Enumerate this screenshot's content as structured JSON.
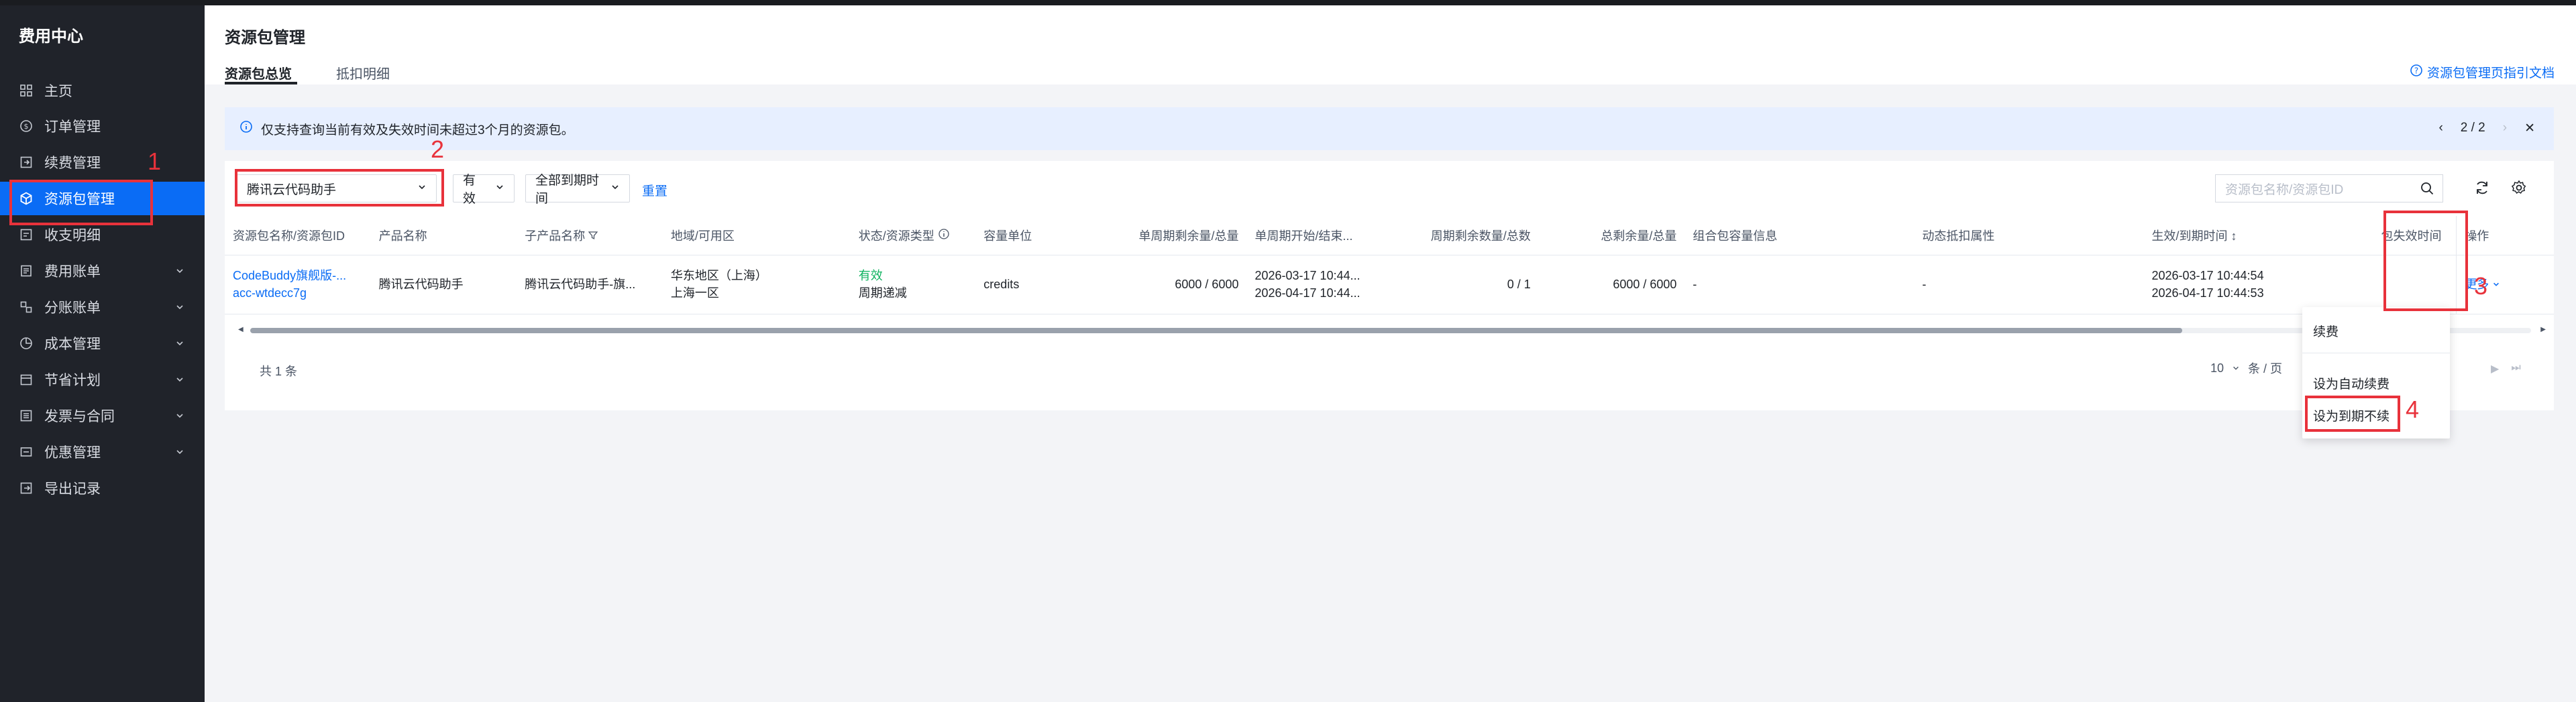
{
  "sidebar": {
    "title": "费用中心",
    "items": [
      {
        "label": "主页",
        "icon": "grid-icon",
        "has_chevron": false
      },
      {
        "label": "订单管理",
        "icon": "order-icon",
        "has_chevron": false
      },
      {
        "label": "续费管理",
        "icon": "renew-icon",
        "has_chevron": false
      },
      {
        "label": "资源包管理",
        "icon": "package-icon",
        "has_chevron": false,
        "active": true
      },
      {
        "label": "收支明细",
        "icon": "receipt-icon",
        "has_chevron": false
      },
      {
        "label": "费用账单",
        "icon": "bill-icon",
        "has_chevron": true
      },
      {
        "label": "分账账单",
        "icon": "split-icon",
        "has_chevron": true
      },
      {
        "label": "成本管理",
        "icon": "pie-icon",
        "has_chevron": true
      },
      {
        "label": "节省计划",
        "icon": "plan-icon",
        "has_chevron": true
      },
      {
        "label": "发票与合同",
        "icon": "invoice-icon",
        "has_chevron": true
      },
      {
        "label": "优惠管理",
        "icon": "discount-icon",
        "has_chevron": true
      },
      {
        "label": "导出记录",
        "icon": "export-icon",
        "has_chevron": false
      }
    ]
  },
  "header": {
    "title": "资源包管理",
    "tabs": [
      "资源包总览",
      "抵扣明细"
    ],
    "doc_link": "资源包管理页指引文档"
  },
  "notice": {
    "text": "仅支持查询当前有效及失效时间未超过3个月的资源包。",
    "page": "2 / 2"
  },
  "filters": {
    "product": "腾讯云代码助手",
    "status": "有效",
    "expiry": "全部到期时间",
    "reset": "重置",
    "search_placeholder": "资源包名称/资源包ID"
  },
  "table": {
    "columns": [
      "资源包名称/资源包ID",
      "产品名称",
      "子产品名称",
      "地域/可用区",
      "状态/资源类型",
      "容量单位",
      "单周期剩余量/总量",
      "单周期开始/结束...",
      "周期剩余数量/总数",
      "总剩余量/总量",
      "组合包容量信息",
      "动态抵扣属性",
      "生效/到期时间",
      "包失效时间",
      "操作"
    ],
    "rows": [
      {
        "name": "CodeBuddy旗舰版-...",
        "id": "acc-wtdecc7g",
        "product": "腾讯云代码助手",
        "subproduct": "腾讯云代码助手-旗...",
        "region": "华东地区（上海）",
        "zone": "上海一区",
        "status": "有效",
        "type": "周期递减",
        "unit": "credits",
        "cycle_remain": "6000 / 6000",
        "cycle_start": "2026-03-17 10:44...",
        "cycle_end": "2026-04-17 10:44...",
        "cycles": "0 / 1",
        "total_remain": "6000 / 6000",
        "combo": "-",
        "dynamic": "-",
        "effective": "2026-03-17 10:44:54",
        "expire": "2026-04-17 10:44:53",
        "action": "更多"
      }
    ]
  },
  "footer": {
    "total": "共 1 条",
    "page_size": "10",
    "per_page": "条 / 页"
  },
  "dropdown": {
    "items": [
      "续费",
      "设为自动续费",
      "设为到期不续"
    ]
  },
  "annotations": [
    "1",
    "2",
    "3",
    "4"
  ],
  "colors": {
    "accent": "#0a6cf5",
    "annotation": "#e8323b",
    "sidebar_bg": "#20232a",
    "status_ok": "#10b360"
  }
}
